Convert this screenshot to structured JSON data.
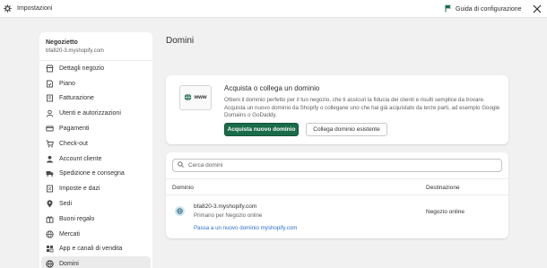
{
  "topbar": {
    "title": "Impostazioni",
    "guide_label": "Guida di configurazione",
    "icons": [
      "gear-icon",
      "flag-icon",
      "close-icon"
    ]
  },
  "sidebar": {
    "store_name": "Negozietto",
    "store_domain": "bfa820-3.myshopify.com",
    "items": [
      {
        "label": "Dettagli negozio",
        "icon": "store-icon"
      },
      {
        "label": "Piano",
        "icon": "plan-icon"
      },
      {
        "label": "Fatturazione",
        "icon": "billing-icon"
      },
      {
        "label": "Utenti e autorizzazioni",
        "icon": "user-icon"
      },
      {
        "label": "Pagamenti",
        "icon": "payment-icon"
      },
      {
        "label": "Check-out",
        "icon": "cart-icon"
      },
      {
        "label": "Account cliente",
        "icon": "customer-icon"
      },
      {
        "label": "Spedizione e consegna",
        "icon": "truck-icon"
      },
      {
        "label": "Imposte e dazi",
        "icon": "tax-icon"
      },
      {
        "label": "Sedi",
        "icon": "location-icon"
      },
      {
        "label": "Buoni regalo",
        "icon": "gift-icon"
      },
      {
        "label": "Mercati",
        "icon": "globe-icon"
      },
      {
        "label": "App e canali di vendita",
        "icon": "apps-icon"
      },
      {
        "label": "Domini",
        "icon": "globe-icon"
      }
    ]
  },
  "main": {
    "title": "Domini",
    "promo": {
      "illustration_text": "www",
      "heading": "Acquista o collega un dominio",
      "description": "Ottieni il dominio perfetto per il tuo negozio, che ti assicuri la fiducia dei clienti e risulti semplice da trovare. Acquista un nuovo dominio da Shopify o collegane uno che hai già acquistato da terze parti, ad esempio Google Domains o GoDaddy.",
      "buy_button": "Acquista nuovo dominio",
      "connect_button": "Collega dominio esistente"
    },
    "domains": {
      "search_placeholder": "Cerca domini",
      "col_domain": "Dominio",
      "col_destination": "Destinazione",
      "row": {
        "domain": "bfa820-3.myshopify.com",
        "status": "Primario per Negozio online",
        "destination": "Negozio online",
        "link": "Passa a un nuovo dominio myshopify.com"
      }
    }
  },
  "colors": {
    "primary_button": "#1a6b4a",
    "link": "#2c6ecb",
    "background": "#f1f1f1"
  }
}
